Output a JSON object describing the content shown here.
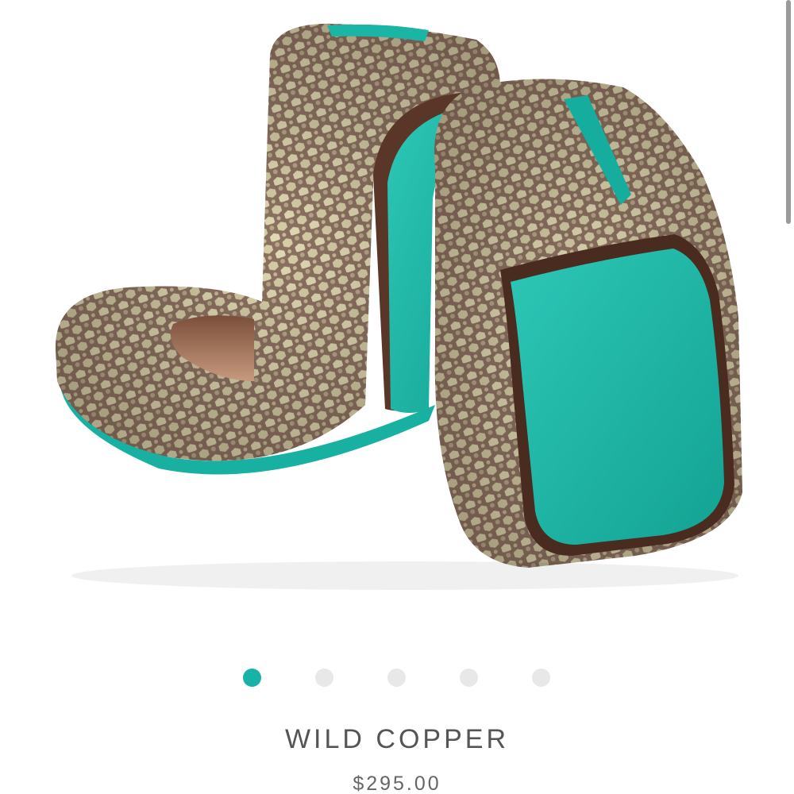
{
  "product": {
    "name": "WILD COPPER",
    "price": "$295.00",
    "image_subject": "snakeskin-print-ballet-flats-with-teal-soles"
  },
  "carousel": {
    "dot_count": 5,
    "active_index": 0
  },
  "colors": {
    "accent": "#16b3a6",
    "dot_inactive": "#e8e8e8",
    "text": "#555555",
    "sole_teal": "#1fb5a6",
    "leather_bronze": "#8f7565"
  }
}
